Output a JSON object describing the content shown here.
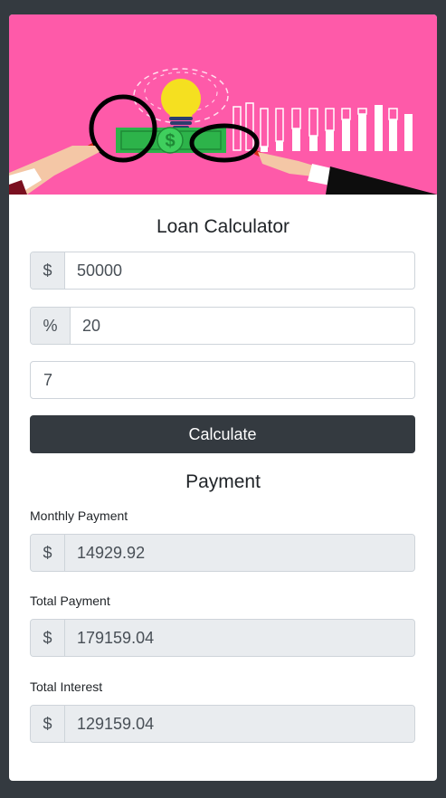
{
  "app": {
    "title": "Loan Calculator",
    "hero_image": "loan-magnifier-illustration",
    "colors": {
      "background": "#343a40",
      "hero": "#fe5aa9",
      "button": "#343a40",
      "addon": "#e9ecef"
    }
  },
  "inputs": {
    "amount": {
      "prefix": "$",
      "value": "50000"
    },
    "interest": {
      "prefix": "%",
      "value": "20"
    },
    "years": {
      "value": "7"
    }
  },
  "calculate_label": "Calculate",
  "results": {
    "heading": "Payment",
    "monthly": {
      "label": "Monthly Payment",
      "prefix": "$",
      "value": "14929.92"
    },
    "total": {
      "label": "Total Payment",
      "prefix": "$",
      "value": "179159.04"
    },
    "interest": {
      "label": "Total Interest",
      "prefix": "$",
      "value": "129159.04"
    }
  }
}
